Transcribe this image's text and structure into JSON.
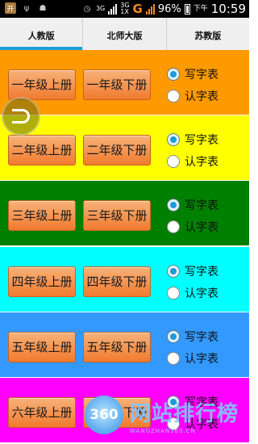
{
  "status_bar": {
    "network_3g_1": "3G",
    "network_3g_2": "3G",
    "network_1x": "1X",
    "carrier_letter": "G",
    "battery": "96%",
    "period": "下午",
    "time": "10:59"
  },
  "tabs": [
    {
      "label": "人教版",
      "active": true
    },
    {
      "label": "北师大版",
      "active": false
    },
    {
      "label": "苏教版",
      "active": false
    }
  ],
  "grades": [
    {
      "color": "#ff9900",
      "up": "一年级上册",
      "down": "一年级下册",
      "opt1": "写字表",
      "opt2": "认字表",
      "selected": 1
    },
    {
      "color": "#ffff00",
      "up": "二年级上册",
      "down": "二年级下册",
      "opt1": "写字表",
      "opt2": "认字表",
      "selected": 1
    },
    {
      "color": "#008000",
      "up": "三年级上册",
      "down": "三年级下册",
      "opt1": "写字表",
      "opt2": "认字表",
      "selected": 1
    },
    {
      "color": "#00ffff",
      "up": "四年级上册",
      "down": "四年级下册",
      "opt1": "写字表",
      "opt2": "认字表",
      "selected": 1
    },
    {
      "color": "#3399ff",
      "up": "五年级上册",
      "down": "五年级下册",
      "opt1": "写字表",
      "opt2": "认字表",
      "selected": 1
    },
    {
      "color": "#ff00ff",
      "up": "六年级上册",
      "down": "六年级下册",
      "opt1": "写字表",
      "opt2": "认字表",
      "selected": 1
    }
  ],
  "watermark": {
    "logo": "360",
    "title": "网站排行榜",
    "url": "WANGZHAN360.CN"
  }
}
